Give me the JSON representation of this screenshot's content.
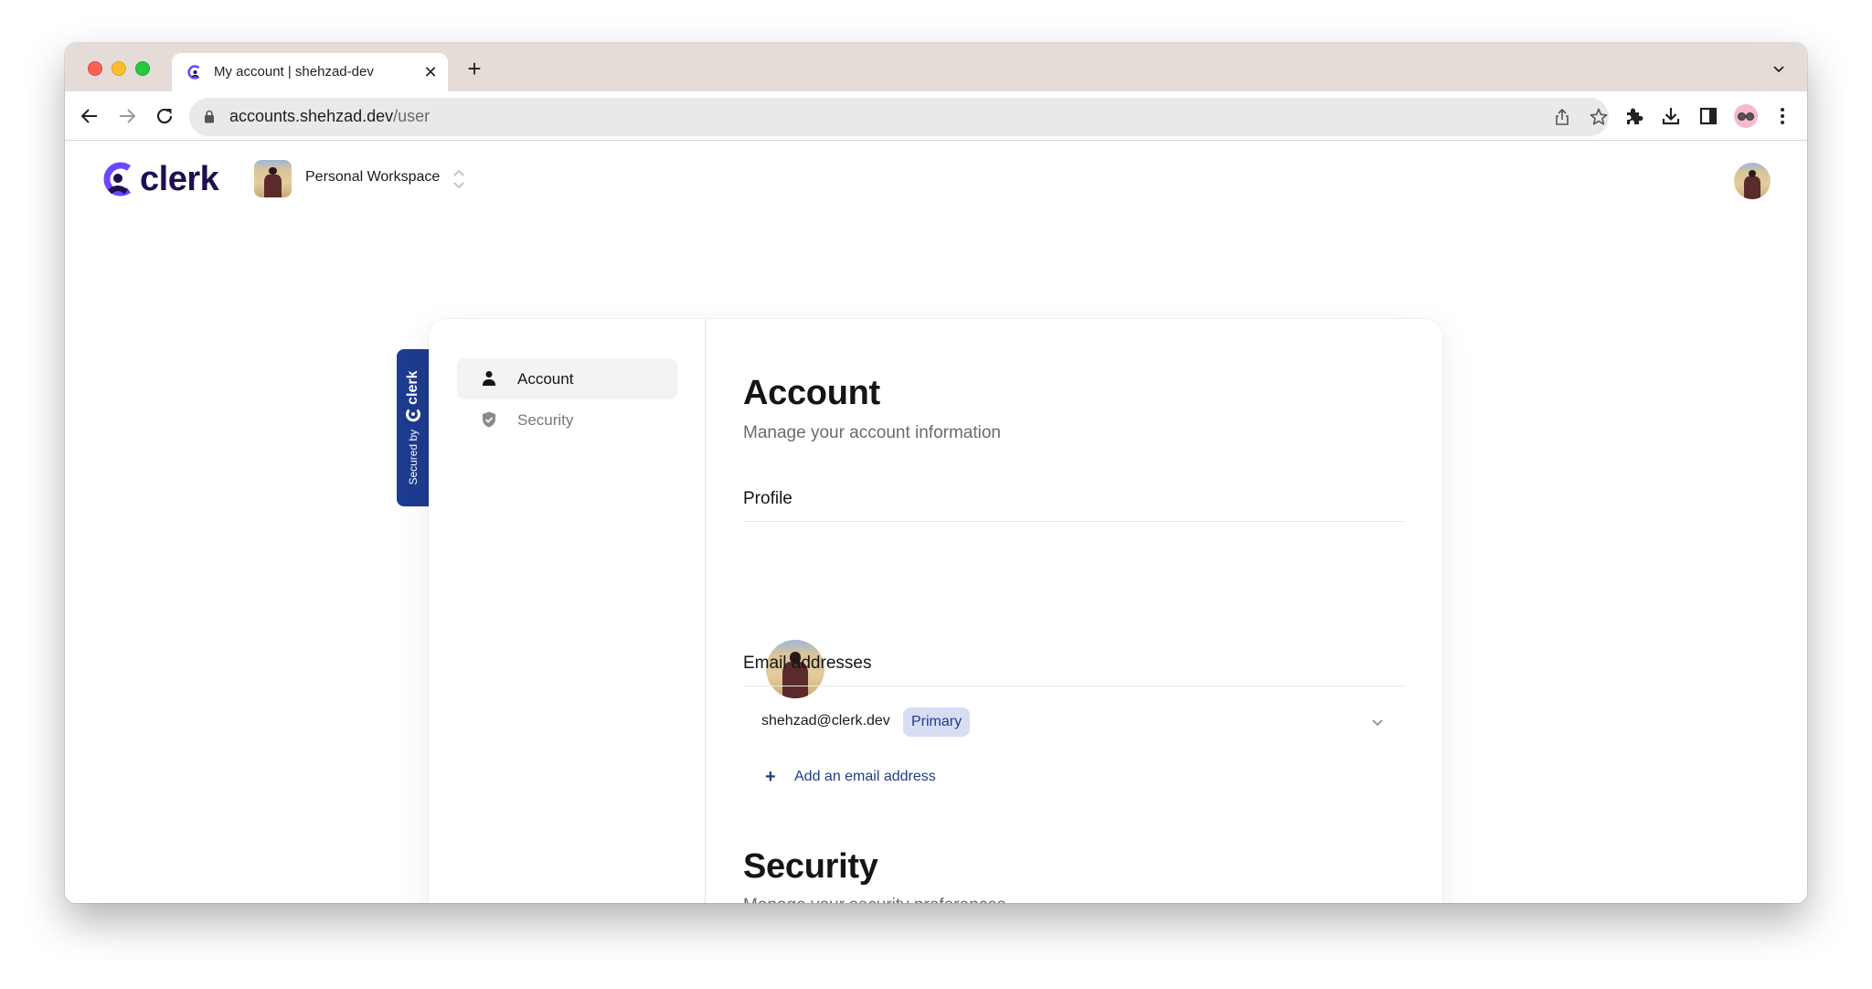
{
  "browser": {
    "tab_title": "My account | shehzad-dev",
    "url_host": "accounts.shehzad.dev",
    "url_path": "/user",
    "icons": [
      "back-icon",
      "forward-icon",
      "reload-icon",
      "lock-icon",
      "share-icon",
      "bookmark-star-icon",
      "extensions-icon",
      "download-icon",
      "side-panel-icon",
      "profile-icon",
      "menu-icon"
    ]
  },
  "header": {
    "logo_text": "clerk",
    "workspace_label": "Personal Workspace"
  },
  "badge": {
    "secured_by": "Secured by",
    "brand": "clerk",
    "color": "#1d3b8f"
  },
  "nav": {
    "items": [
      {
        "label": "Account",
        "icon": "user-icon",
        "active": true
      },
      {
        "label": "Security",
        "icon": "shield-check-icon",
        "active": false
      }
    ]
  },
  "account": {
    "title": "Account",
    "subtitle": "Manage your account information",
    "profile_label": "Profile",
    "email_label": "Email addresses",
    "emails": [
      {
        "address": "shehzad@clerk.dev",
        "badge": "Primary"
      }
    ],
    "add_email_label": "Add an email address"
  },
  "security": {
    "title": "Security",
    "subtitle": "Manage your security preferences"
  },
  "colors": {
    "accent": "#233b8a",
    "badge_bg": "#d7def4",
    "logo_primary": "#6c47ff",
    "logo_dark": "#1f0f4f"
  }
}
